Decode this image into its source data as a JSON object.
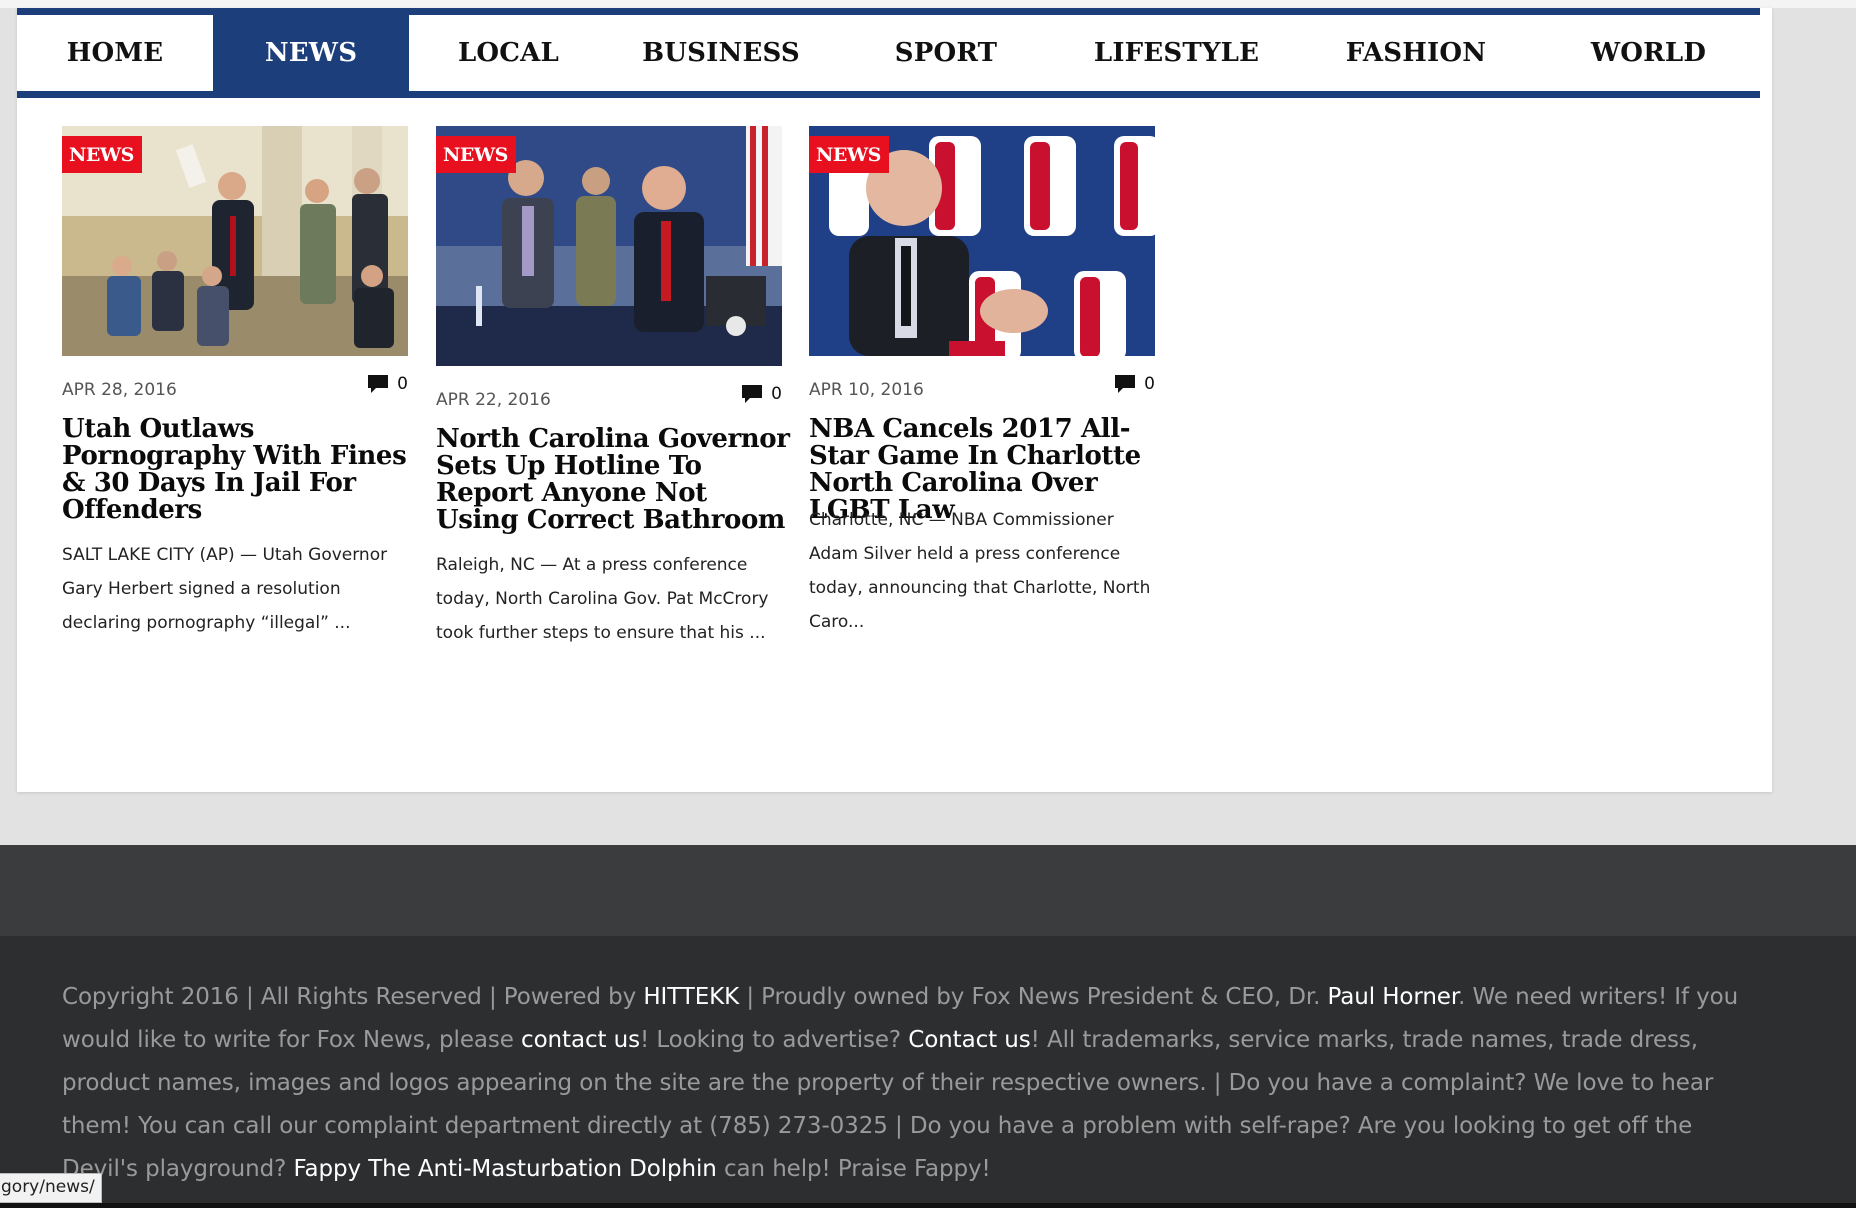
{
  "nav": {
    "items": [
      {
        "label": "HOME"
      },
      {
        "label": "NEWS"
      },
      {
        "label": "LOCAL"
      },
      {
        "label": "BUSINESS"
      },
      {
        "label": "SPORT"
      },
      {
        "label": "LIFESTYLE"
      },
      {
        "label": "FASHION"
      },
      {
        "label": "WORLD"
      }
    ],
    "active": "NEWS",
    "active_color": "#1c3f7c"
  },
  "articles": [
    {
      "category": "NEWS",
      "date": "APR 28, 2016",
      "comments": "0",
      "title": "Utah Outlaws Pornography With Fines & 30 Days In Jail For Offenders",
      "excerpt": "SALT LAKE CITY (AP) — Utah Governor Gary Herbert signed a resolution declaring pornography “illegal” ..."
    },
    {
      "category": "NEWS",
      "date": "APR 22, 2016",
      "comments": "0",
      "title": "North Carolina Governor Sets Up Hotline To Report Anyone Not Using Correct Bathroom",
      "excerpt": "Raleigh, NC — At a press conference today, North Carolina Gov. Pat McCrory took further steps to ensure that his ..."
    },
    {
      "category": "NEWS",
      "date": "APR 10, 2016",
      "comments": "0",
      "title": "NBA Cancels 2017 All-Star Game In Charlotte North Carolina Over LGBT Law",
      "excerpt": "Charlotte, NC — NBA Commissioner Adam Silver held a press conference today, announcing that Charlotte, North Caro..."
    }
  ],
  "footer": {
    "t1": "Copyright 2016 | All Rights Reserved | Powered by ",
    "link_hittekk": "HITTEKK",
    "t2": " | Proudly owned by Fox News President & CEO, Dr. ",
    "link_horner": "Paul Horner",
    "t3": ". We need writers! If you would like to write for Fox News, please ",
    "link_contact1": "contact us",
    "t4": "! Looking to advertise? ",
    "link_contact2": "Contact us",
    "t5": "! All trademarks, service marks, trade names, trade dress, product names, images and logos appearing on the site are the property of their respective owners. | Do you have a complaint? We love to hear them! You can call our complaint department directly at (785) 273-0325 | Do you have a problem with self-rape? Are you looking to get off the Devil's playground? ",
    "link_fappy": "Fappy The Anti-Masturbation Dolphin",
    "t6": " can help! Praise Fappy!"
  },
  "status_bar": {
    "url": "gory/news/"
  },
  "colors": {
    "brand_blue": "#1c3f7c",
    "tag_red": "#e8101f",
    "footer_bg": "#2d2e30"
  }
}
